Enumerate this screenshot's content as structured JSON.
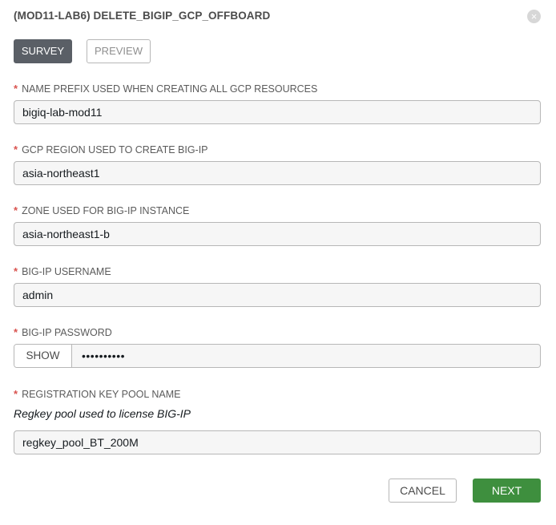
{
  "dialog": {
    "title": "(MOD11-LAB6) DELETE_BIGIP_GCP_OFFBOARD",
    "close_icon": "close-icon"
  },
  "tabs": [
    {
      "label": "SURVEY",
      "active": true
    },
    {
      "label": "PREVIEW",
      "active": false
    }
  ],
  "required_marker": "*",
  "fields": {
    "name_prefix": {
      "label": "NAME PREFIX USED WHEN CREATING ALL GCP RESOURCES",
      "value": "bigiq-lab-mod11"
    },
    "gcp_region": {
      "label": "GCP REGION USED TO CREATE BIG-IP",
      "value": "asia-northeast1"
    },
    "zone": {
      "label": "ZONE USED FOR BIG-IP INSTANCE",
      "value": "asia-northeast1-b"
    },
    "username": {
      "label": "BIG-IP USERNAME",
      "value": "admin"
    },
    "password": {
      "label": "BIG-IP PASSWORD",
      "show_label": "SHOW",
      "masked_value": "••••••••••"
    },
    "regkey_pool": {
      "label": "REGISTRATION KEY POOL NAME",
      "hint": "Regkey pool used to license BIG-IP",
      "value": "regkey_pool_BT_200M"
    }
  },
  "actions": {
    "cancel_label": "CANCEL",
    "next_label": "NEXT"
  },
  "colors": {
    "active_tab": "#5a5f66",
    "next_button": "#3e8f3e",
    "required": "#d9534f"
  }
}
